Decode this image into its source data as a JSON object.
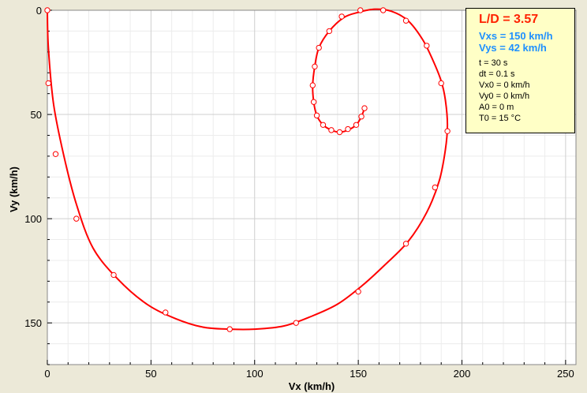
{
  "chart_data": {
    "type": "line",
    "xlabel": "Vx (km/h)",
    "ylabel": "Vy (km/h)",
    "xlim": [
      0,
      255
    ],
    "ylim": [
      0,
      170
    ],
    "y_axis_inverted": true,
    "grid": true,
    "x_ticks": [
      "0",
      "50",
      "100",
      "150",
      "200",
      "250"
    ],
    "y_ticks": [
      "0",
      "50",
      "100",
      "150"
    ],
    "line_color": "#ff0000",
    "marker": "hollow-circle",
    "series": [
      {
        "points": [
          [
            0,
            0
          ],
          [
            0.5,
            18
          ],
          [
            3,
            45
          ],
          [
            8,
            70
          ],
          [
            14,
            93
          ],
          [
            22,
            114
          ],
          [
            34,
            129
          ],
          [
            48,
            141
          ],
          [
            62,
            148
          ],
          [
            75,
            152
          ],
          [
            88,
            153
          ],
          [
            100,
            153
          ],
          [
            114,
            151.5
          ],
          [
            127,
            147
          ],
          [
            140,
            141
          ],
          [
            152,
            132
          ],
          [
            163,
            122
          ],
          [
            174,
            111
          ],
          [
            183,
            97
          ],
          [
            189,
            82
          ],
          [
            192,
            67
          ],
          [
            193,
            55
          ],
          [
            192,
            43
          ],
          [
            190,
            34
          ],
          [
            186,
            24
          ],
          [
            181,
            14
          ],
          [
            174,
            5
          ],
          [
            166,
            0.5
          ],
          [
            158,
            -0.5
          ],
          [
            150,
            1
          ],
          [
            143,
            3.5
          ],
          [
            136,
            10
          ],
          [
            131,
            18
          ],
          [
            129,
            27
          ],
          [
            128,
            36
          ],
          [
            128.5,
            44
          ],
          [
            130,
            50.5
          ],
          [
            133,
            55
          ],
          [
            137,
            57.5
          ],
          [
            141,
            58.5
          ],
          [
            145,
            57.5
          ],
          [
            149,
            55
          ],
          [
            151.5,
            51
          ],
          [
            153,
            47
          ]
        ],
        "markers": [
          [
            0,
            0
          ],
          [
            0.5,
            35
          ],
          [
            4,
            69
          ],
          [
            14,
            100
          ],
          [
            32,
            127
          ],
          [
            57,
            145
          ],
          [
            88,
            153
          ],
          [
            120,
            150
          ],
          [
            150,
            135
          ],
          [
            173,
            112
          ],
          [
            187,
            85
          ],
          [
            193,
            58
          ],
          [
            190,
            35
          ],
          [
            183,
            17
          ],
          [
            173,
            5
          ],
          [
            162,
            0
          ],
          [
            151,
            0
          ],
          [
            142,
            3
          ],
          [
            136,
            10
          ],
          [
            131,
            18
          ],
          [
            129,
            27
          ],
          [
            128,
            36
          ],
          [
            128.5,
            44
          ],
          [
            130,
            50.5
          ],
          [
            133,
            55
          ],
          [
            137,
            57.5
          ],
          [
            141,
            58.5
          ],
          [
            145,
            57
          ],
          [
            149,
            55
          ],
          [
            151.5,
            51
          ],
          [
            153,
            47
          ]
        ]
      }
    ]
  },
  "info_box": {
    "ld": "L/D = 3.57",
    "vxs": "Vxs = 150 km/h",
    "vys": "Vys = 42 km/h",
    "params": [
      "t = 30 s",
      "dt = 0.1 s",
      "Vx0 = 0 km/h",
      "Vy0 = 0 km/h",
      "A0 = 0 m",
      "T0 = 15 °C"
    ]
  }
}
